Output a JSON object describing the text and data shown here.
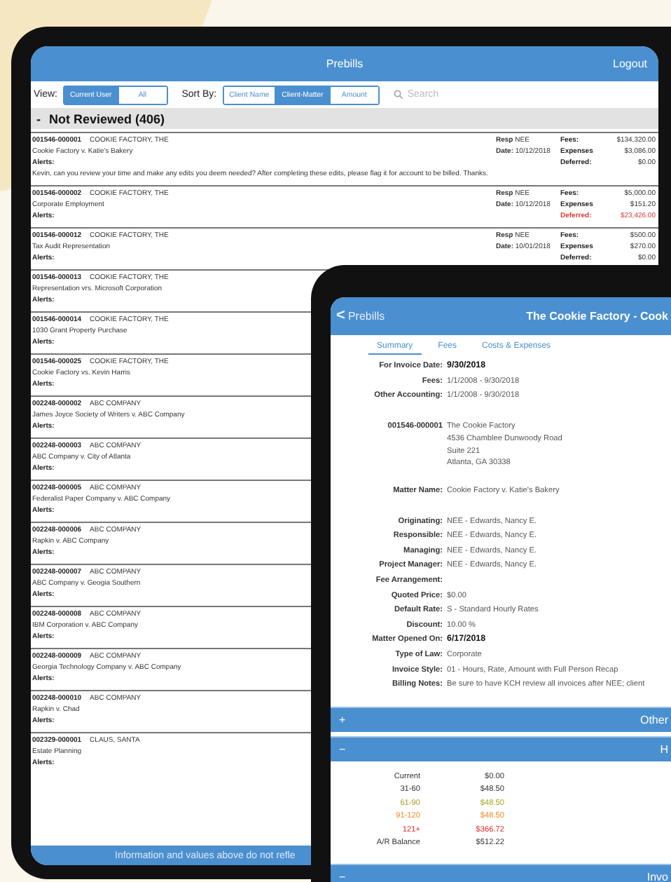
{
  "prebills_screen": {
    "header": {
      "title": "Prebills",
      "logout": "Logout"
    },
    "toolbar": {
      "view_label": "View:",
      "view_options": [
        {
          "label": "Current User",
          "selected": true
        },
        {
          "label": "All",
          "selected": false
        }
      ],
      "sort_label": "Sort By:",
      "sort_options": [
        {
          "label": "Client Name",
          "selected": false
        },
        {
          "label": "Client-Matter",
          "selected": true
        },
        {
          "label": "Amount",
          "selected": false
        }
      ],
      "search": {
        "placeholder": "Search"
      }
    },
    "section": {
      "toggle": "-",
      "title": "Not Reviewed (406)"
    },
    "prebills": [
      {
        "matter": "001546-000001",
        "client": "COOKIE FACTORY, THE",
        "description": "Cookie Factory v. Katie's Bakery",
        "alerts": "Alerts:",
        "note": "Kevin, can you review your time and make any edits you deem needed?  After completing these edits, please flag it for account to be billed. Thanks.",
        "resp_label": "Resp",
        "resp": "NEE",
        "date_label": "Date:",
        "date": "10/12/2018",
        "amounts": [
          {
            "label": "Fees:",
            "value": "$134,320.00",
            "alert": false
          },
          {
            "label": "Expenses",
            "value": "$3,086.00",
            "alert": false
          },
          {
            "label": "Deferred:",
            "value": "$0.00",
            "alert": false
          }
        ]
      },
      {
        "matter": "001546-000002",
        "client": "COOKIE FACTORY, THE",
        "description": "Corporate Employment",
        "alerts": "Alerts:",
        "resp_label": "Resp",
        "resp": "NEE",
        "date_label": "Date:",
        "date": "10/12/2018",
        "amounts": [
          {
            "label": "Fees:",
            "value": "$5,000.00",
            "alert": false
          },
          {
            "label": "Expenses",
            "value": "$151.20",
            "alert": false
          },
          {
            "label": "Deferred:",
            "value": "$23,426.00",
            "alert": true
          }
        ]
      },
      {
        "matter": "001546-000012",
        "client": "COOKIE FACTORY, THE",
        "description": "Tax Audit Representation",
        "alerts": "Alerts:",
        "resp_label": "Resp",
        "resp": "NEE",
        "date_label": "Date:",
        "date": "10/01/2018",
        "amounts": [
          {
            "label": "Fees:",
            "value": "$500.00",
            "alert": false
          },
          {
            "label": "Expenses",
            "value": "$270.00",
            "alert": false
          },
          {
            "label": "Deferred:",
            "value": "$0.00",
            "alert": false
          }
        ]
      },
      {
        "matter": "001546-000013",
        "client": "COOKIE FACTORY, THE",
        "description": "Representation vrs. Microsoft Corporation",
        "alerts": "Alerts:"
      },
      {
        "matter": "001546-000014",
        "client": "COOKIE FACTORY, THE",
        "description": "1030 Grant Property Purchase",
        "alerts": "Alerts:"
      },
      {
        "matter": "001546-000025",
        "client": "COOKIE FACTORY, THE",
        "description": "Cookie Factory vs. Kevin Harris",
        "alerts": "Alerts:"
      },
      {
        "matter": "002248-000002",
        "client": "ABC COMPANY",
        "description": "James Joyce Society of Writers v. ABC Company",
        "alerts": "Alerts:"
      },
      {
        "matter": "002248-000003",
        "client": "ABC COMPANY",
        "description": "ABC Company v. City of Atlanta",
        "alerts": "Alerts:"
      },
      {
        "matter": "002248-000005",
        "client": "ABC COMPANY",
        "description": "Federalist Paper Company v. ABC Company",
        "alerts": "Alerts:"
      },
      {
        "matter": "002248-000006",
        "client": "ABC COMPANY",
        "description": "Rapkin v. ABC Company",
        "alerts": "Alerts:"
      },
      {
        "matter": "002248-000007",
        "client": "ABC COMPANY",
        "description": "ABC Company v. Geogia Southern",
        "alerts": "Alerts:"
      },
      {
        "matter": "002248-000008",
        "client": "ABC COMPANY",
        "description": "IBM Corporation v. ABC Company",
        "alerts": "Alerts:"
      },
      {
        "matter": "002248-000009",
        "client": "ABC COMPANY",
        "description": "Georgia Technology Company v. ABC Company",
        "alerts": "Alerts:"
      },
      {
        "matter": "002248-000010",
        "client": "ABC COMPANY",
        "description": "Rapkin v. Chad",
        "alerts": "Alerts:"
      },
      {
        "matter": "002329-000001",
        "client": "CLAUS, SANTA",
        "description": "Estate Planning",
        "alerts": "Alerts:"
      }
    ],
    "footer": "Information and values above do not refle"
  },
  "detail_screen": {
    "header": {
      "back_icon": "<",
      "back": "Prebills",
      "title": "The Cookie Factory - Cook"
    },
    "tabs": [
      {
        "label": "Summary",
        "selected": true
      },
      {
        "label": "Fees",
        "selected": false
      },
      {
        "label": "Costs & Expenses",
        "selected": false
      }
    ],
    "field_groups": [
      [
        {
          "label": "For Invoice Date:",
          "value": "9/30/2018",
          "emphasized": true
        },
        {
          "label": "Fees:",
          "value": "1/1/2008 - 9/30/2018",
          "emphasized": false
        },
        {
          "label": "Other Accounting:",
          "value": "1/1/2008 - 9/30/2018",
          "emphasized": false
        }
      ],
      [
        {
          "label": "001546-000001",
          "value": "The Cookie Factory",
          "emphasized": false,
          "lines": [
            "4536 Chamblee Dunwoody Road",
            "Suite 221",
            "Atlanta, GA 30338"
          ]
        }
      ],
      [
        {
          "label": "Matter Name:",
          "value": "Cookie Factory v. Katie's Bakery",
          "emphasized": false
        }
      ],
      [
        {
          "label": "Originating:",
          "value": "NEE - Edwards, Nancy E.",
          "emphasized": false
        },
        {
          "label": "Responsible:",
          "value": "NEE - Edwards, Nancy E.",
          "emphasized": false
        },
        {
          "label": "Managing:",
          "value": "NEE - Edwards, Nancy E.",
          "emphasized": false
        },
        {
          "label": "Project Manager:",
          "value": "NEE - Edwards, Nancy E.",
          "emphasized": false
        },
        {
          "label": "Fee Arrangement:"
        },
        {
          "label": "Quoted Price:",
          "value": "$0.00",
          "emphasized": false
        },
        {
          "label": "Default Rate:",
          "value": "S - Standard Hourly Rates",
          "emphasized": false
        },
        {
          "label": "Discount:",
          "value": "10.00 %",
          "emphasized": false
        },
        {
          "label": "Matter Opened On:",
          "value": "6/17/2018",
          "emphasized": true
        },
        {
          "label": "Type of Law:",
          "value": "Corporate",
          "emphasized": false
        },
        {
          "label": "Invoice Style:",
          "value": "01 - Hours, Rate, Amount with Full Person Recap",
          "emphasized": false
        },
        {
          "label": "Billing Notes:",
          "value": "Be sure to have KCH review all invoices after NEE; client",
          "emphasized": false
        }
      ]
    ],
    "sections": [
      {
        "toggle": "+",
        "title": "Other"
      },
      {
        "toggle": "−",
        "title": "H",
        "aging": [
          {
            "label": "Current",
            "value": "$0.00",
            "color": "#333333"
          },
          {
            "label": "31-60",
            "value": "$48.50",
            "color": "#333333"
          },
          {
            "label": "61-90",
            "value": "$48.50",
            "color": "#a6a51f"
          },
          {
            "label": "91-120",
            "value": "$48.50",
            "color": "#f08a1c"
          },
          {
            "label": "121+",
            "value": "$366.72",
            "color": "#e8262a"
          },
          {
            "label": "A/R Balance",
            "value": "$512.22",
            "color": "#333333"
          }
        ]
      },
      {
        "toggle": "−",
        "title": "Invo"
      }
    ]
  }
}
